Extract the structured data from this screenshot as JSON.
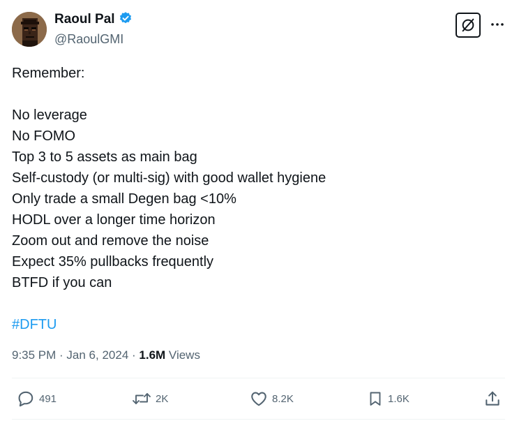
{
  "author": {
    "display_name": "Raoul Pal",
    "handle": "@RaoulGMI",
    "avatar_icon": "pixel-art-punk-avatar",
    "verified_color": "#1d9bf0"
  },
  "tweet": {
    "lines": [
      "Remember:",
      "",
      "No leverage",
      "No FOMO",
      "Top 3 to 5 assets as main bag",
      "Self-custody (or multi-sig) with good wallet hygiene",
      "Only trade a small Degen bag <10%",
      "HODL over a longer time horizon",
      "Zoom out and remove the noise",
      "Expect 35% pullbacks frequently",
      "BTFD if you can",
      ""
    ],
    "hashtag": "#DFTU",
    "hashtag_color": "#1d9bf0"
  },
  "meta": {
    "time": "9:35 PM",
    "separator1": " · ",
    "date": "Jan 6, 2024",
    "separator2": " · ",
    "views_count": "1.6M",
    "views_label": " Views"
  },
  "actions": {
    "replies": {
      "icon": "reply-icon",
      "count": "491"
    },
    "reposts": {
      "icon": "repost-icon",
      "count": "2K"
    },
    "likes": {
      "icon": "heart-icon",
      "count": "8.2K"
    },
    "bookmarks": {
      "icon": "bookmark-icon",
      "count": "1.6K"
    },
    "share": {
      "icon": "share-icon"
    }
  },
  "toolbar": {
    "grok_icon": "grok-icon",
    "more_icon": "more-options-icon"
  }
}
